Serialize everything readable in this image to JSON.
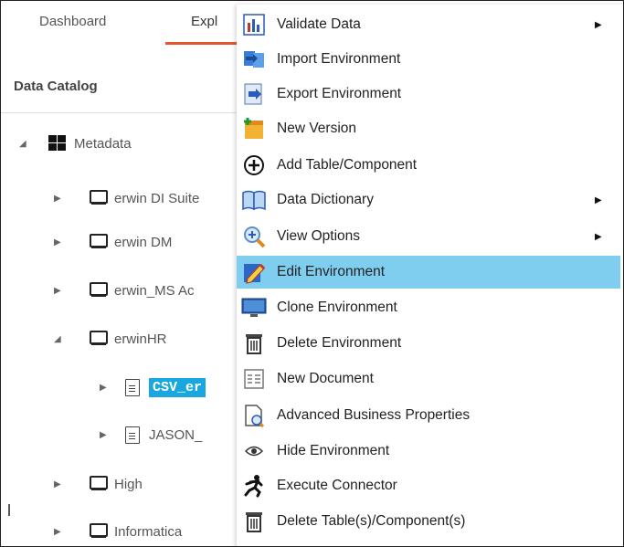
{
  "tabs": {
    "dashboard": "Dashboard",
    "explorer": "Expl"
  },
  "catalog": {
    "title": "Data Catalog"
  },
  "tree": {
    "metadata": "Metadata",
    "erwin_di": "erwin DI Suite",
    "erwin_dm": "erwin DM",
    "erwin_ms": "erwin_MS Ac",
    "erwinhr": "erwinHR",
    "csv": "CSV_er",
    "jason": "JASON_",
    "high": "High",
    "informatica": "Informatica"
  },
  "menu": {
    "items": [
      {
        "label": "Validate Data",
        "icon": "bar-chart-icon",
        "submenu": true
      },
      {
        "label": "Import Environment",
        "icon": "import-icon",
        "submenu": false
      },
      {
        "label": "Export Environment",
        "icon": "export-icon",
        "submenu": false
      },
      {
        "label": "New Version",
        "icon": "new-version-icon",
        "submenu": false
      },
      {
        "label": "Add Table/Component",
        "icon": "plus-circle-icon",
        "submenu": false
      },
      {
        "label": "Data Dictionary",
        "icon": "book-icon",
        "submenu": true
      },
      {
        "label": "View Options",
        "icon": "magnifier-icon",
        "submenu": true
      },
      {
        "label": "Edit Environment",
        "icon": "pencil-icon",
        "submenu": false
      },
      {
        "label": "Clone Environment",
        "icon": "monitor-icon",
        "submenu": false
      },
      {
        "label": "Delete Environment",
        "icon": "trash-icon",
        "submenu": false
      },
      {
        "label": "New Document",
        "icon": "document-icon",
        "submenu": false
      },
      {
        "label": "Advanced Business Properties",
        "icon": "properties-icon",
        "submenu": false
      },
      {
        "label": "Hide Environment",
        "icon": "eye-icon",
        "submenu": false
      },
      {
        "label": "Execute Connector",
        "icon": "runner-icon",
        "submenu": false
      },
      {
        "label": "Delete Table(s)/Component(s)",
        "icon": "trash-icon",
        "submenu": false
      }
    ]
  },
  "colors": {
    "highlight": "#80ceef",
    "selected": "#1aa7e0",
    "accent": "#e4572e"
  }
}
